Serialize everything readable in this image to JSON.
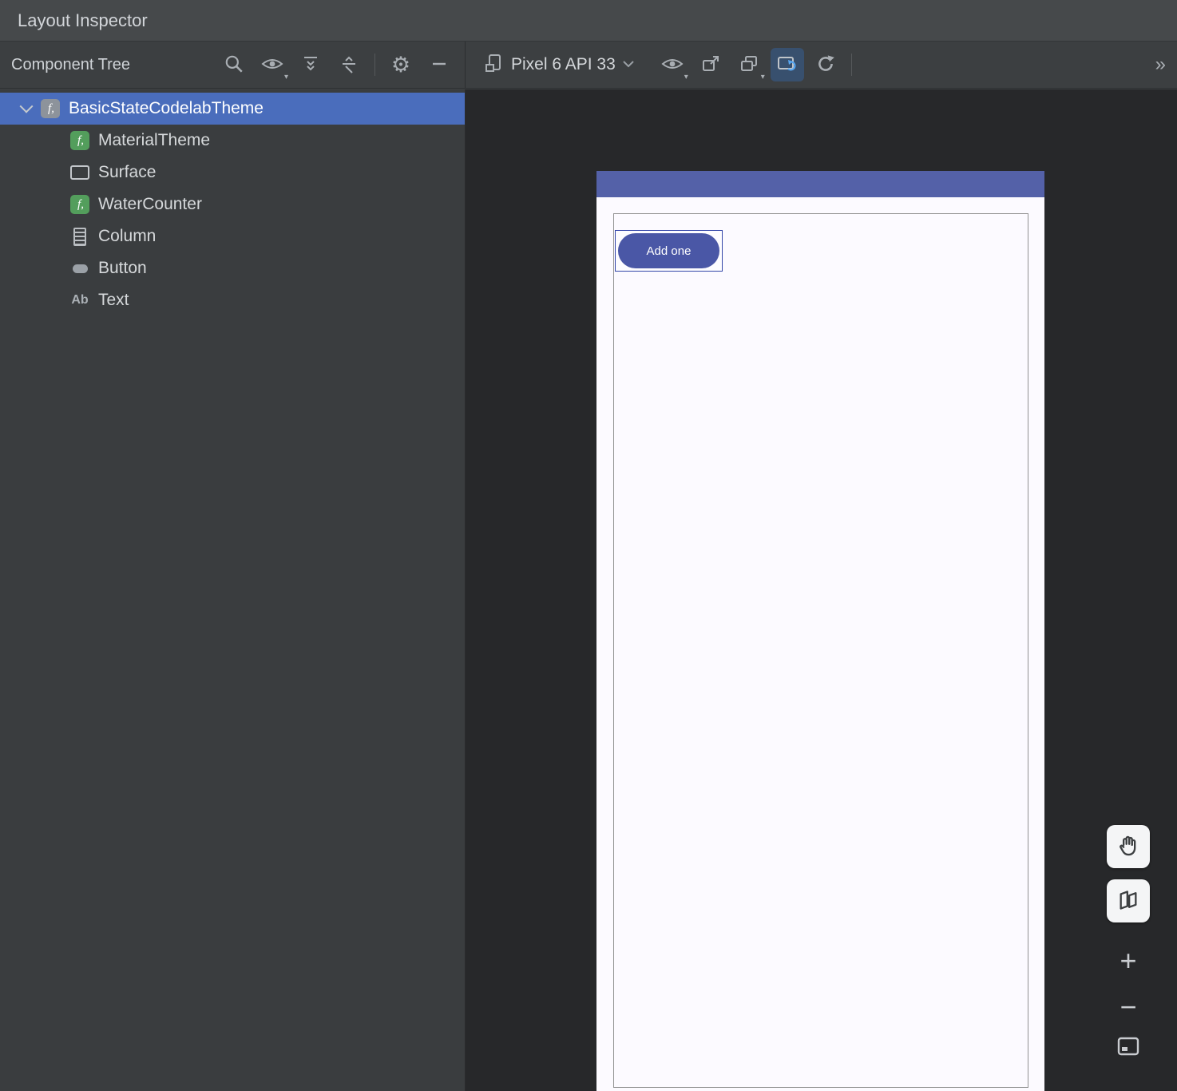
{
  "window": {
    "title": "Layout Inspector"
  },
  "toolbar": {
    "tree_panel_label": "Component Tree",
    "device_selector_label": "Pixel 6 API 33",
    "overflow_label": "»",
    "icons_left": [
      "search-icon",
      "view-options-eye-icon",
      "expand-all-icon",
      "collapse-all-icon",
      "settings-gear-icon",
      "hide-panel-minus-icon"
    ],
    "icons_right": [
      "visibility-eye-icon",
      "export-snapshot-icon",
      "layers-icon",
      "live-updates-toggle-icon",
      "refresh-icon"
    ]
  },
  "component_tree": {
    "items": [
      {
        "label": "BasicStateCodelabTheme",
        "icon": "compose-gray",
        "depth": 0,
        "selected": true,
        "expanded": true
      },
      {
        "label": "MaterialTheme",
        "icon": "compose-green",
        "depth": 1
      },
      {
        "label": "Surface",
        "icon": "surface",
        "depth": 1
      },
      {
        "label": "WaterCounter",
        "icon": "compose-green",
        "depth": 1
      },
      {
        "label": "Column",
        "icon": "column",
        "depth": 1
      },
      {
        "label": "Button",
        "icon": "button",
        "depth": 1
      },
      {
        "label": "Text",
        "icon": "text",
        "icon_text": "Ab",
        "depth": 1
      }
    ]
  },
  "device_screen": {
    "button_label": "Add one"
  },
  "canvas_controls": [
    "pan-hand-icon",
    "mode-3d-icon",
    "zoom-in-icon",
    "zoom-out-icon",
    "zoom-fit-icon"
  ],
  "colors": {
    "selection_blue": "#4a6dbc",
    "compose_icon_green": "#539e5c",
    "device_statusbar_indigo": "#5461a8",
    "device_button_indigo": "#4a57a6",
    "toggle_active_bg": "#38506e",
    "panel_bg": "#3c3f41",
    "canvas_bg": "#27282a"
  }
}
